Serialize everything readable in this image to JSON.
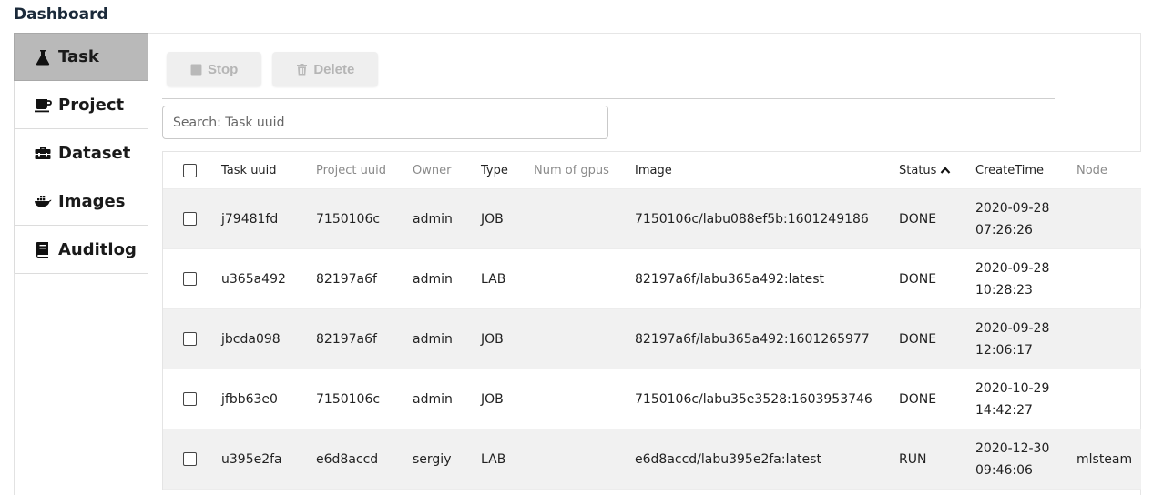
{
  "app": {
    "title": "Dashboard"
  },
  "sidebar": {
    "items": [
      {
        "label": "Task",
        "icon": "flask-icon",
        "active": true
      },
      {
        "label": "Project",
        "icon": "coffee-cup-icon",
        "active": false
      },
      {
        "label": "Dataset",
        "icon": "toolbox-icon",
        "active": false
      },
      {
        "label": "Images",
        "icon": "docker-whale-icon",
        "active": false
      },
      {
        "label": "Auditlog",
        "icon": "book-icon",
        "active": false
      }
    ]
  },
  "toolbar": {
    "stop_label": "Stop",
    "delete_label": "Delete"
  },
  "search": {
    "placeholder": "Search: Task uuid",
    "value": ""
  },
  "table": {
    "columns": [
      "Task uuid",
      "Project uuid",
      "Owner",
      "Type",
      "Num of gpus",
      "Image",
      "Status",
      "CreateTime",
      "Node"
    ],
    "sort": {
      "column": "Status",
      "direction": "ascending"
    },
    "rows": [
      {
        "task_uuid": "j79481fd",
        "project_uuid": "7150106c",
        "owner": "admin",
        "type": "JOB",
        "gpus": "",
        "image": "7150106c/labu088ef5b:1601249186",
        "status": "DONE",
        "date": "2020-09-28",
        "time": "07:26:26",
        "node": ""
      },
      {
        "task_uuid": "u365a492",
        "project_uuid": "82197a6f",
        "owner": "admin",
        "type": "LAB",
        "gpus": "",
        "image": "82197a6f/labu365a492:latest",
        "status": "DONE",
        "date": "2020-09-28",
        "time": "10:28:23",
        "node": ""
      },
      {
        "task_uuid": "jbcda098",
        "project_uuid": "82197a6f",
        "owner": "admin",
        "type": "JOB",
        "gpus": "",
        "image": "82197a6f/labu365a492:1601265977",
        "status": "DONE",
        "date": "2020-09-28",
        "time": "12:06:17",
        "node": ""
      },
      {
        "task_uuid": "jfbb63e0",
        "project_uuid": "7150106c",
        "owner": "admin",
        "type": "JOB",
        "gpus": "",
        "image": "7150106c/labu35e3528:1603953746",
        "status": "DONE",
        "date": "2020-10-29",
        "time": "14:42:27",
        "node": ""
      },
      {
        "task_uuid": "u395e2fa",
        "project_uuid": "e6d8accd",
        "owner": "sergiy",
        "type": "LAB",
        "gpus": "",
        "image": "e6d8accd/labu395e2fa:latest",
        "status": "RUN",
        "date": "2020-12-30",
        "time": "09:46:06",
        "node": "mlsteam"
      }
    ]
  }
}
